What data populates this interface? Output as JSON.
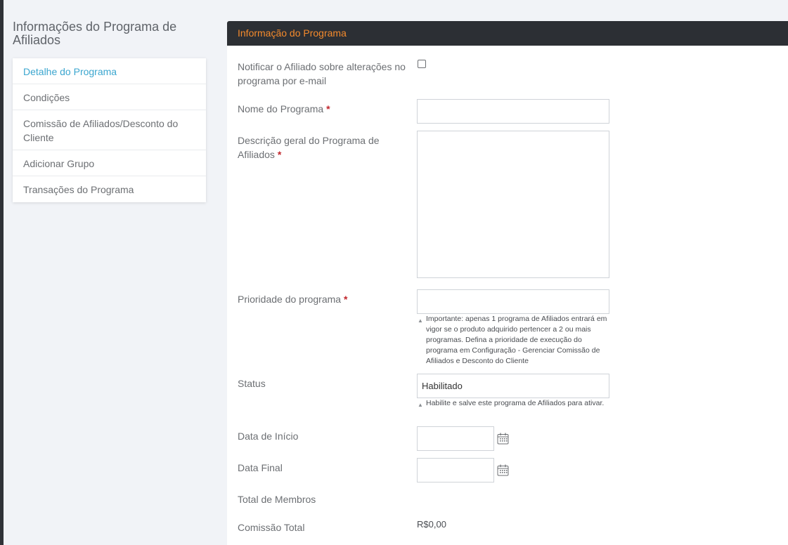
{
  "sidebar": {
    "title": "Informações do Programa de Afiliados",
    "items": [
      {
        "label": "Detalhe do Programa",
        "active": true
      },
      {
        "label": "Condições"
      },
      {
        "label": "Comissão de Afiliados/Desconto do Cliente"
      },
      {
        "label": "Adicionar Grupo"
      },
      {
        "label": "Transações do Programa"
      }
    ]
  },
  "panel": {
    "title": "Informação do Programa"
  },
  "form": {
    "notify_label": "Notificar o Afiliado sobre alterações no programa por e-mail",
    "notify_checked": false,
    "program_name_label": "Nome do Programa",
    "program_name_value": "",
    "description_label": "Descrição geral do Programa de Afiliados",
    "description_value": "",
    "priority_label": "Prioridade do programa",
    "priority_value": "",
    "priority_hint": "Importante: apenas 1 programa de Afiliados entrará em vigor se o produto adquirido pertencer a 2 ou mais programas. Defina a prioridade de execução do programa em Configuração - Gerenciar Comissão de Afiliados e Desconto do Cliente",
    "status_label": "Status",
    "status_value": "Habilitado",
    "status_hint": "Habilite e salve este programa de Afiliados para ativar.",
    "start_date_label": "Data de Início",
    "start_date_value": "",
    "end_date_label": "Data Final",
    "end_date_value": "",
    "total_members_label": "Total de Membros",
    "total_members_value": "",
    "total_commission_label": "Comissão Total",
    "total_commission_value": "R$0,00",
    "required_mark": "*"
  },
  "icons": {
    "calendar": "calendar-icon",
    "hint": "triangle-up-icon"
  },
  "colors": {
    "accent_blue": "#3ba6cf",
    "header_orange": "#f48a2c",
    "header_bg": "#2c2f34",
    "required_red": "#c1272d"
  }
}
